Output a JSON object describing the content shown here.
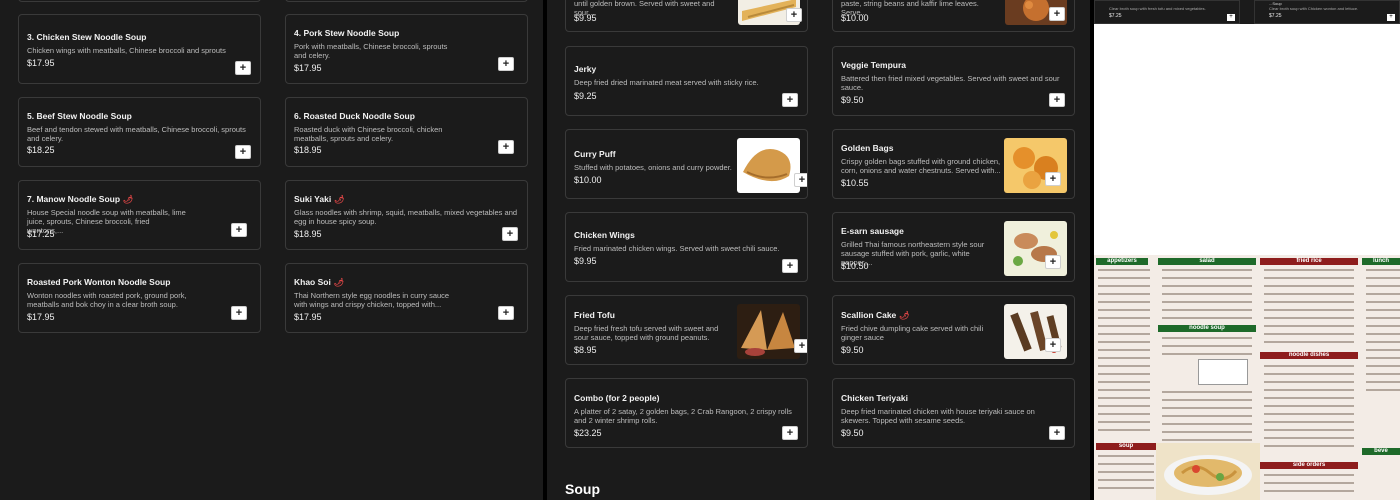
{
  "panel1": {
    "items": [
      {
        "name": "3. Chicken Stew Noodle Soup",
        "desc": "Chicken wings with meatballs, Chinese broccoli and sprouts",
        "price": "$17.95"
      },
      {
        "name": "4. Pork Stew Noodle Soup",
        "desc": "Pork with meatballs, Chinese broccoli, sprouts and celery.",
        "price": "$17.95"
      },
      {
        "name": "5. Beef Stew Noodle Soup",
        "desc": "Beef and tendon stewed with meatballs, Chinese broccoli, sprouts and celery.",
        "price": "$18.25"
      },
      {
        "name": "6. Roasted Duck Noodle Soup",
        "desc": "Roasted duck with Chinese broccoli, chicken meatballs, sprouts and celery.",
        "price": "$18.95"
      },
      {
        "name": "7. Manow Noodle Soup",
        "desc": "House Special noodle soup with meatballs, lime juice, sprouts, Chinese broccoli, fried wontons,...",
        "price": "$17.25"
      },
      {
        "name": "Suki Yaki",
        "desc": "Glass noodles with shrimp, squid, meatballs, mixed vegetables and egg in house spicy soup.",
        "price": "$18.95"
      },
      {
        "name": "Roasted Pork Wonton Noodle Soup",
        "desc": "Wonton noodles with roasted pork, ground pork, meatballs and bok choy in a clear broth soup.",
        "price": "$17.95"
      },
      {
        "name": "Khao Soi",
        "desc": "Thai Northern style egg noodles in curry sauce with wings and crispy chicken, topped with...",
        "price": "$17.95"
      }
    ]
  },
  "panel2": {
    "top_left": {
      "desc": "until golden brown. Served with sweet and sour...",
      "price": "$9.95"
    },
    "top_right": {
      "desc": "paste, string beans and kaffir lime leaves. Serve...",
      "price": "$10.00"
    },
    "items": [
      {
        "name": "Jerky",
        "desc": "Deep fried dried marinated meat served with sticky rice.",
        "price": "$9.25"
      },
      {
        "name": "Veggie Tempura",
        "desc": "Battered then fried mixed vegetables. Served with sweet and sour sauce.",
        "price": "$9.50"
      },
      {
        "name": "Curry Puff",
        "desc": "Stuffed with potatoes, onions and curry powder.",
        "price": "$10.00"
      },
      {
        "name": "Golden Bags",
        "desc": "Crispy golden bags stuffed with ground chicken, corn, onions and water chestnuts. Served with...",
        "price": "$10.55"
      },
      {
        "name": "Chicken Wings",
        "desc": "Fried marinated chicken wings. Served with sweet chili sauce.",
        "price": "$9.95"
      },
      {
        "name": "E-sarn sausage",
        "desc": "Grilled Thai famous northeastern style sour sausage stuffed with pork, garlic, white pepper,...",
        "price": "$10.50"
      },
      {
        "name": "Fried Tofu",
        "desc": "Deep fried fresh tofu served with sweet and sour sauce, topped with ground peanuts.",
        "price": "$8.95"
      },
      {
        "name": "Scallion Cake",
        "desc": "Fried chive dumpling cake served with chili ginger sauce",
        "price": "$9.50"
      },
      {
        "name": "Combo (for 2 people)",
        "desc": "A platter of 2 satay, 2 golden bags, 2 Crab Rangoon, 2 crispy rolls and 2 winter shrimp rolls.",
        "price": "$23.25"
      },
      {
        "name": "Chicken Teriyaki",
        "desc": "Deep fried marinated chicken with house teriyaki sauce on skewers. Topped with sesame seeds.",
        "price": "$9.50"
      }
    ],
    "section_title": "Soup"
  },
  "panel3": {
    "mini_left": {
      "desc": "Clear broth soup with fresh tofu and mixed vegetables.",
      "price": "$7.25"
    },
    "mini_right": {
      "title": "...Soup",
      "desc": "Clear broth soup with Chicken wonton and lettuce.",
      "price": "$7.25"
    },
    "menu_headers": [
      "appetizers",
      "salad",
      "fried rice",
      "lunch",
      "noodle soup",
      "noodle dishes",
      "soup",
      "side orders",
      "beve"
    ]
  },
  "icons": {
    "add": "+",
    "spicy": "🌶"
  },
  "colors": {
    "bg": "#1b1b1b",
    "card_border": "#3a3a3a",
    "spicy": "#e04646",
    "menu_green": "#1e6a2a",
    "menu_red": "#8e1d1d"
  }
}
